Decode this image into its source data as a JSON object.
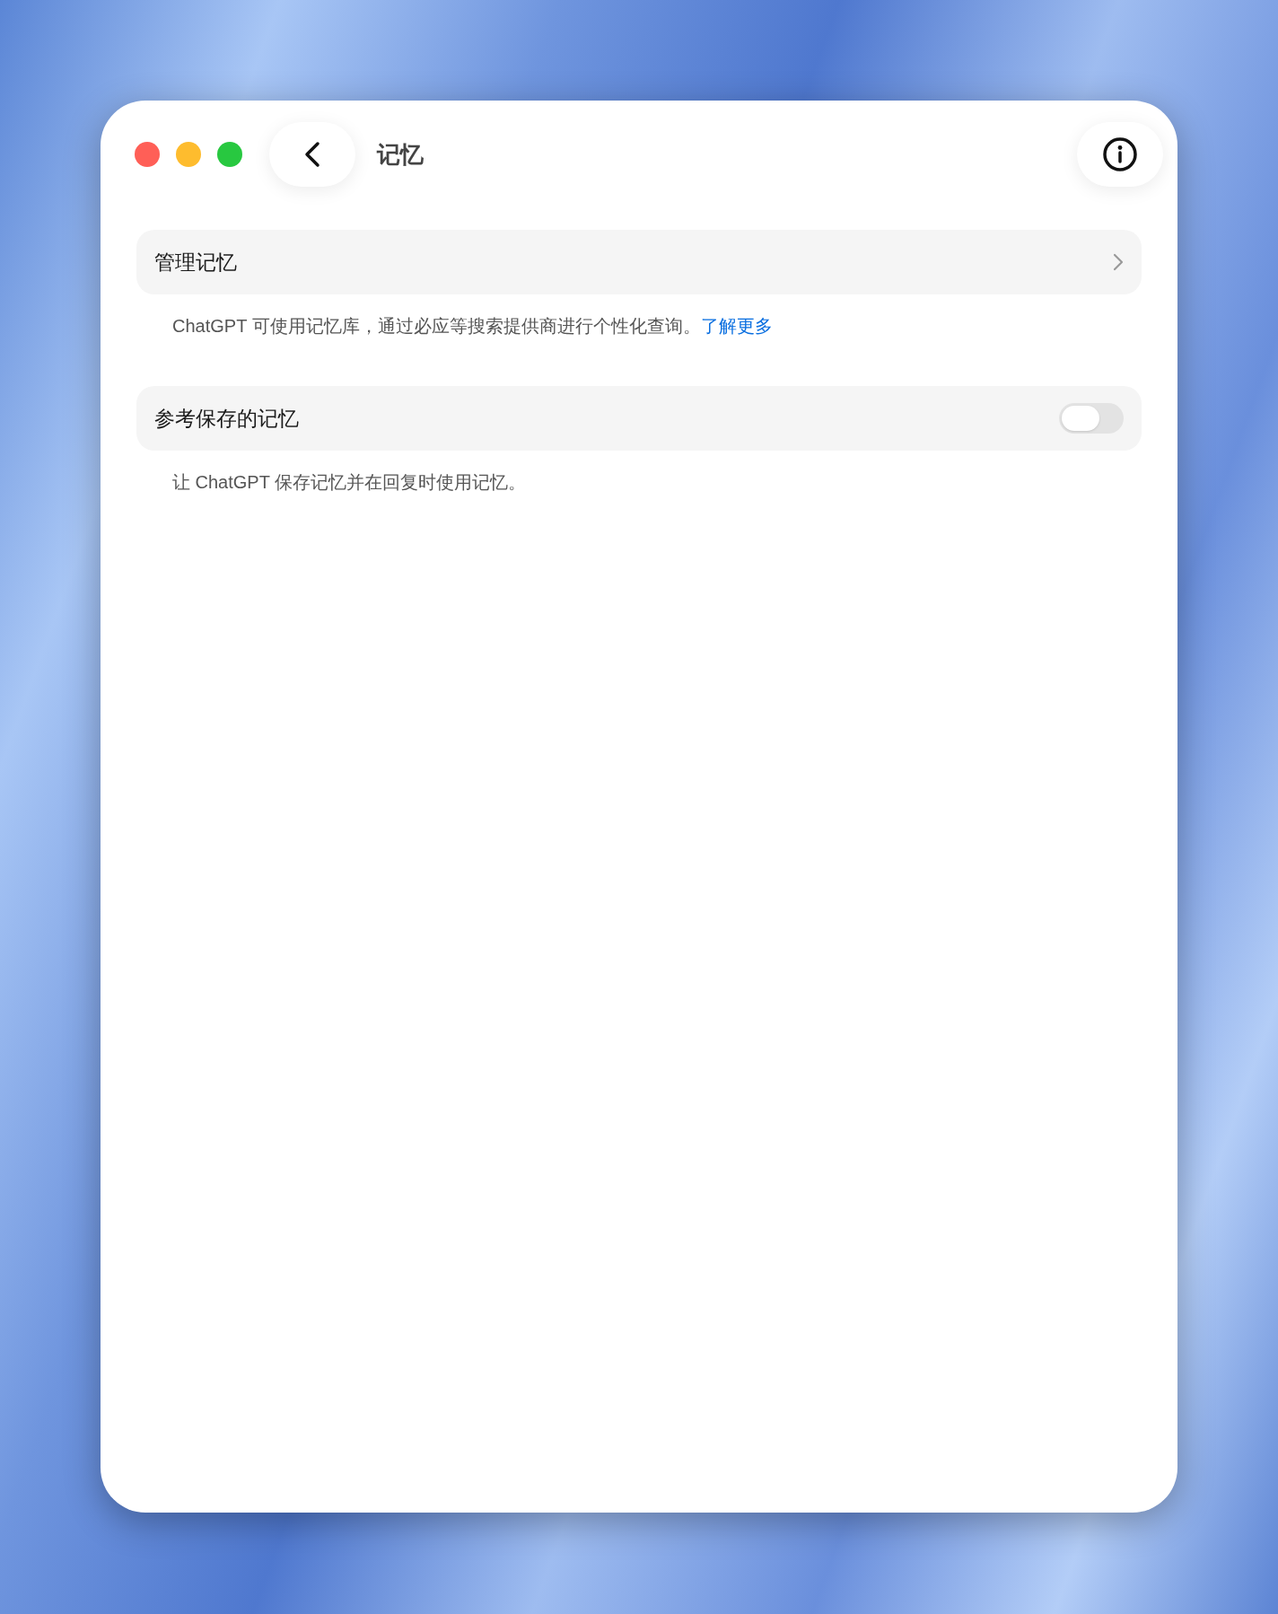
{
  "window": {
    "title": "记忆",
    "traffic_lights": [
      {
        "color": "#ff5f57"
      },
      {
        "color": "#febc2e"
      },
      {
        "color": "#28c840"
      }
    ]
  },
  "sections": [
    {
      "kind": "link",
      "label": "管理记忆",
      "description": "ChatGPT 可使用记忆库，通过必应等搜索提供商进行个性化查询。",
      "link": "了解更多"
    },
    {
      "kind": "toggle",
      "label": "参考保存的记忆",
      "on": false,
      "description": "让 ChatGPT 保存记忆并在回复时使用记忆。"
    }
  ]
}
